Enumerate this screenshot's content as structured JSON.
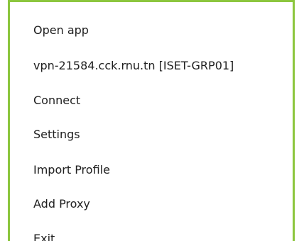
{
  "context_menu": {
    "items": [
      {
        "label": "Open app"
      },
      {
        "label": "vpn-21584.cck.rnu.tn [ISET-GRP01]"
      },
      {
        "label": "Connect"
      },
      {
        "label": "Settings"
      },
      {
        "label": "Import Profile"
      },
      {
        "label": "Add Proxy"
      },
      {
        "label": "Exit"
      }
    ]
  },
  "colors": {
    "menu_border": "#8cc63e",
    "menu_background": "#ffffff",
    "text": "#202020"
  }
}
